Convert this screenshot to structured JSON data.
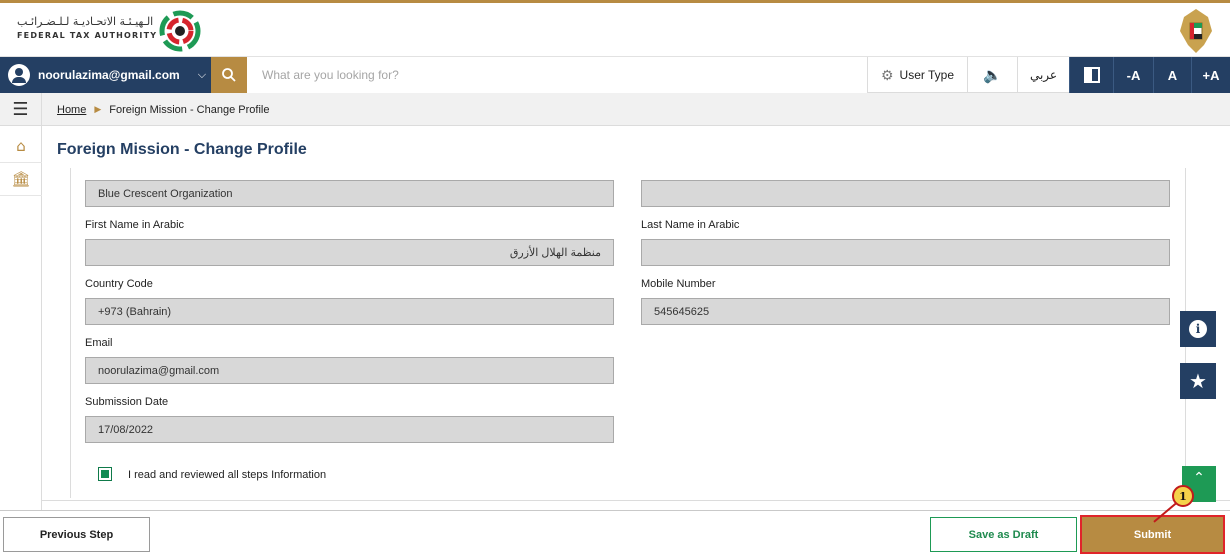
{
  "header": {
    "logo_arabic": "الـهيـئـة الاتحـاديـة لـلـضـرائـب",
    "logo_english": "FEDERAL TAX AUTHORITY"
  },
  "toolbar": {
    "user_email": "noorulazima@gmail.com",
    "search_placeholder": "What are you looking for?",
    "user_type_label": "User Type",
    "arabic_label": "عربي",
    "font_decrease": "-A",
    "font_normal": "A",
    "font_increase": "+A"
  },
  "breadcrumb": {
    "home": "Home",
    "current": "Foreign Mission - Change Profile"
  },
  "page": {
    "title": "Foreign Mission - Change Profile"
  },
  "form": {
    "org_name_value": "Blue Crescent Organization",
    "top_right_value": "",
    "first_name_ar_label": "First Name in Arabic",
    "first_name_ar_value": "منظمة الهلال الأزرق",
    "last_name_ar_label": "Last Name in Arabic",
    "last_name_ar_value": "",
    "country_code_label": "Country Code",
    "country_code_value": "+973 (Bahrain)",
    "mobile_label": "Mobile Number",
    "mobile_value": "545645625",
    "email_label": "Email",
    "email_value": "noorulazima@gmail.com",
    "submission_date_label": "Submission Date",
    "submission_date_value": "17/08/2022",
    "confirm_label": "I read and reviewed all steps Information"
  },
  "footer": {
    "previous_label": "Previous Step",
    "draft_label": "Save as Draft",
    "submit_label": "Submit"
  },
  "annotation": {
    "marker_number": "1"
  },
  "colors": {
    "navy": "#243f63",
    "gold": "#b78b42",
    "green": "#1e9a55",
    "highlight_red": "#e0242a"
  }
}
